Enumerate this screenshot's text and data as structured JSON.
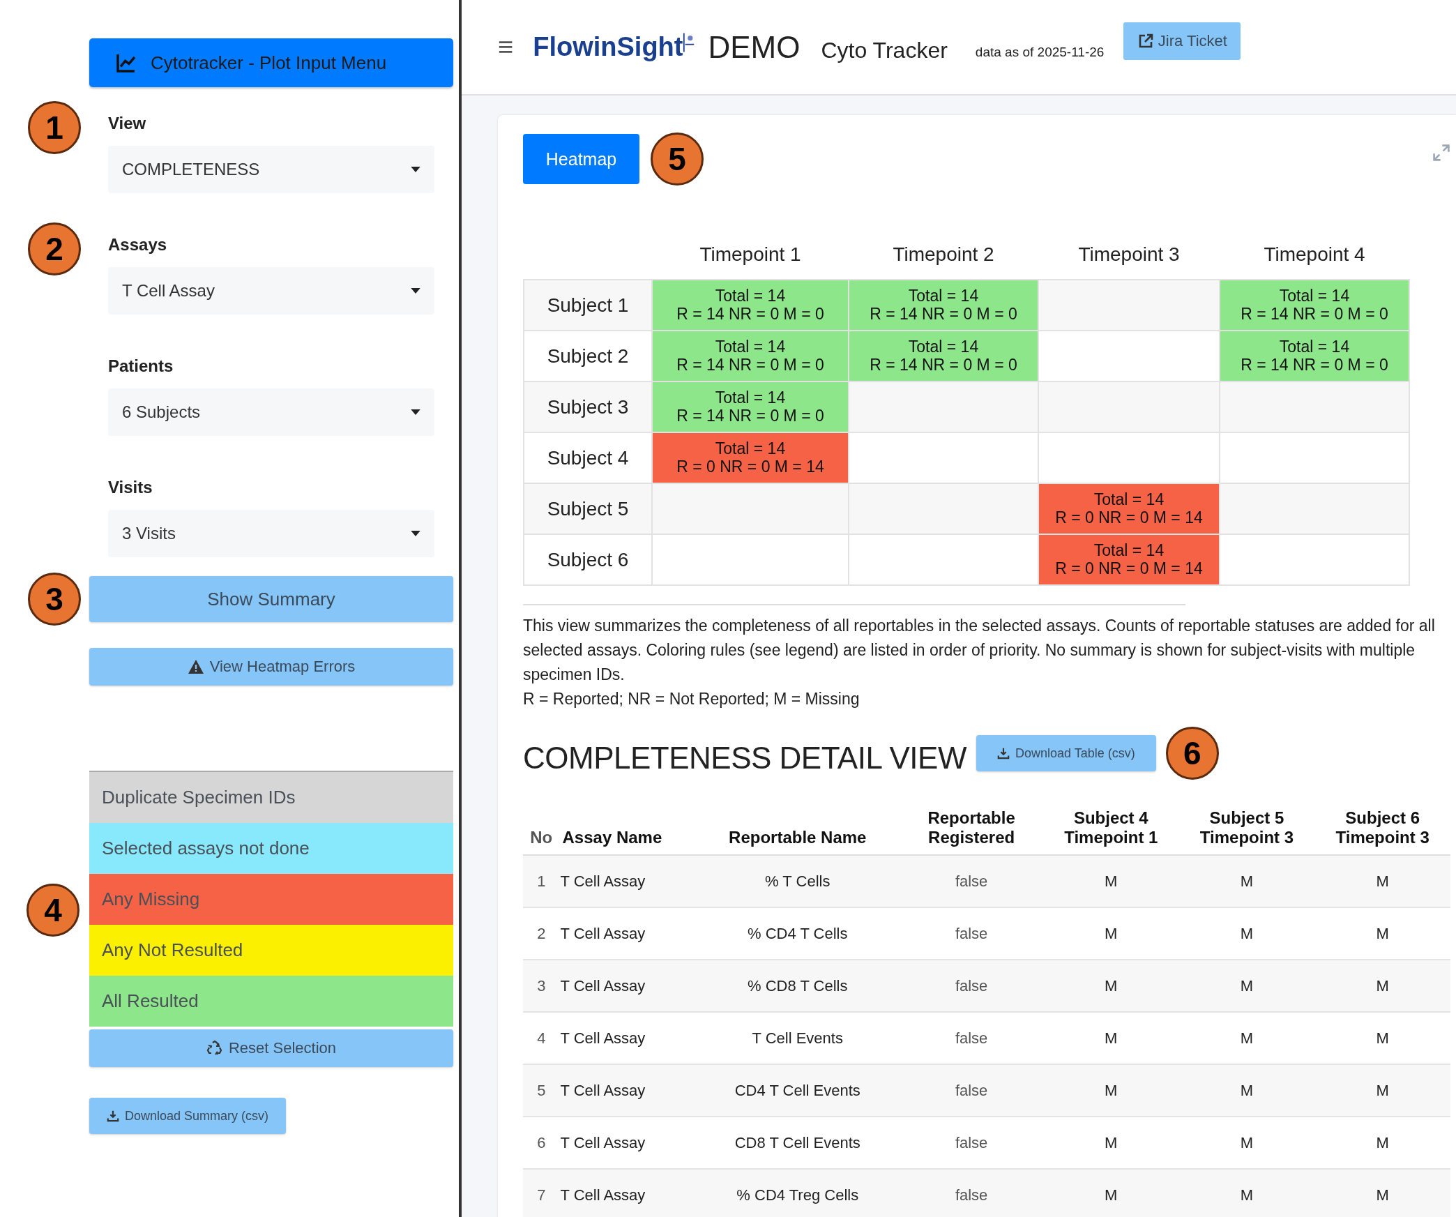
{
  "sidebar": {
    "menu_button": "Cytotracker - Plot Input Menu",
    "inputs": [
      {
        "label": "View",
        "value": "COMPLETENESS",
        "callout": "1"
      },
      {
        "label": "Assays",
        "value": "T Cell Assay",
        "callout": "2"
      },
      {
        "label": "Patients",
        "value": "6 Subjects"
      },
      {
        "label": "Visits",
        "value": "3 Visits"
      }
    ],
    "show_summary": {
      "label": "Show Summary",
      "callout": "3"
    },
    "errors_button": "View Heatmap Errors",
    "legend": {
      "callout": "4",
      "items": [
        {
          "label": "Duplicate Specimen IDs",
          "color": "#d6d6d6"
        },
        {
          "label": "Selected assays not done",
          "color": "#87e9fb"
        },
        {
          "label": "Any Missing",
          "color": "#f66246"
        },
        {
          "label": "Any Not Resulted",
          "color": "#fbf000"
        },
        {
          "label": "All Resulted",
          "color": "#8ee68a"
        }
      ]
    },
    "reset_button": "Reset Selection",
    "download_button": "Download Summary (csv)"
  },
  "header": {
    "menu_glyph": "≡",
    "logo": "FlowinSight",
    "demo": "DEMO",
    "app_title": "Cyto Tracker",
    "data_date": "data as of 2025-11-26",
    "jira_button": "Jira Ticket"
  },
  "heatmap": {
    "tab": "Heatmap",
    "callout": "5",
    "columns": [
      "Timepoint 1",
      "Timepoint 2",
      "Timepoint 3",
      "Timepoint 4"
    ],
    "rows": [
      {
        "subject": "Subject 1",
        "cells": [
          {
            "total": "Total = 14",
            "counts": "R = 14 NR = 0 M = 0",
            "color": "#8ee68a"
          },
          {
            "total": "Total = 14",
            "counts": "R = 14 NR = 0 M = 0",
            "color": "#8ee68a"
          },
          null,
          {
            "total": "Total = 14",
            "counts": "R = 14 NR = 0 M = 0",
            "color": "#8ee68a"
          }
        ]
      },
      {
        "subject": "Subject 2",
        "cells": [
          {
            "total": "Total = 14",
            "counts": "R = 14 NR = 0 M = 0",
            "color": "#8ee68a"
          },
          {
            "total": "Total = 14",
            "counts": "R = 14 NR = 0 M = 0",
            "color": "#8ee68a"
          },
          null,
          {
            "total": "Total = 14",
            "counts": "R = 14 NR = 0 M = 0",
            "color": "#8ee68a"
          }
        ]
      },
      {
        "subject": "Subject 3",
        "cells": [
          {
            "total": "Total = 14",
            "counts": "R = 14 NR = 0 M = 0",
            "color": "#8ee68a"
          },
          null,
          null,
          null
        ]
      },
      {
        "subject": "Subject 4",
        "cells": [
          {
            "total": "Total = 14",
            "counts": "R = 0 NR = 0 M = 14",
            "color": "#f66246"
          },
          null,
          null,
          null
        ]
      },
      {
        "subject": "Subject 5",
        "cells": [
          null,
          null,
          {
            "total": "Total = 14",
            "counts": "R = 0 NR = 0 M = 14",
            "color": "#f66246"
          },
          null
        ]
      },
      {
        "subject": "Subject 6",
        "cells": [
          null,
          null,
          {
            "total": "Total = 14",
            "counts": "R = 0 NR = 0 M = 14",
            "color": "#f66246"
          },
          null
        ]
      }
    ]
  },
  "description": {
    "paragraph": "This view summarizes the completeness of all reportables in the selected assays. Counts of reportable statuses are added for all selected assays. Coloring rules (see legend) are listed in order of priority. No summary is shown for subject-visits with multiple specimen IDs.",
    "key": "R = Reported; NR = Not Reported; M = Missing"
  },
  "detail": {
    "title": "COMPLETENESS DETAIL VIEW",
    "download_button": "Download Table (csv)",
    "callout": "6",
    "columns": [
      "No",
      "Assay Name",
      "Reportable Name",
      "Reportable\nRegistered",
      "Subject 4\nTimepoint 1",
      "Subject 5\nTimepoint 3",
      "Subject 6\nTimepoint 3"
    ],
    "rows": [
      [
        "1",
        "T Cell Assay",
        "% T Cells",
        "false",
        "M",
        "M",
        "M"
      ],
      [
        "2",
        "T Cell Assay",
        "% CD4 T Cells",
        "false",
        "M",
        "M",
        "M"
      ],
      [
        "3",
        "T Cell Assay",
        "% CD8 T Cells",
        "false",
        "M",
        "M",
        "M"
      ],
      [
        "4",
        "T Cell Assay",
        "T Cell Events",
        "false",
        "M",
        "M",
        "M"
      ],
      [
        "5",
        "T Cell Assay",
        "CD4 T Cell Events",
        "false",
        "M",
        "M",
        "M"
      ],
      [
        "6",
        "T Cell Assay",
        "CD8 T Cell Events",
        "false",
        "M",
        "M",
        "M"
      ],
      [
        "7",
        "T Cell Assay",
        "% CD4 Treg Cells",
        "false",
        "M",
        "M",
        "M"
      ]
    ]
  }
}
